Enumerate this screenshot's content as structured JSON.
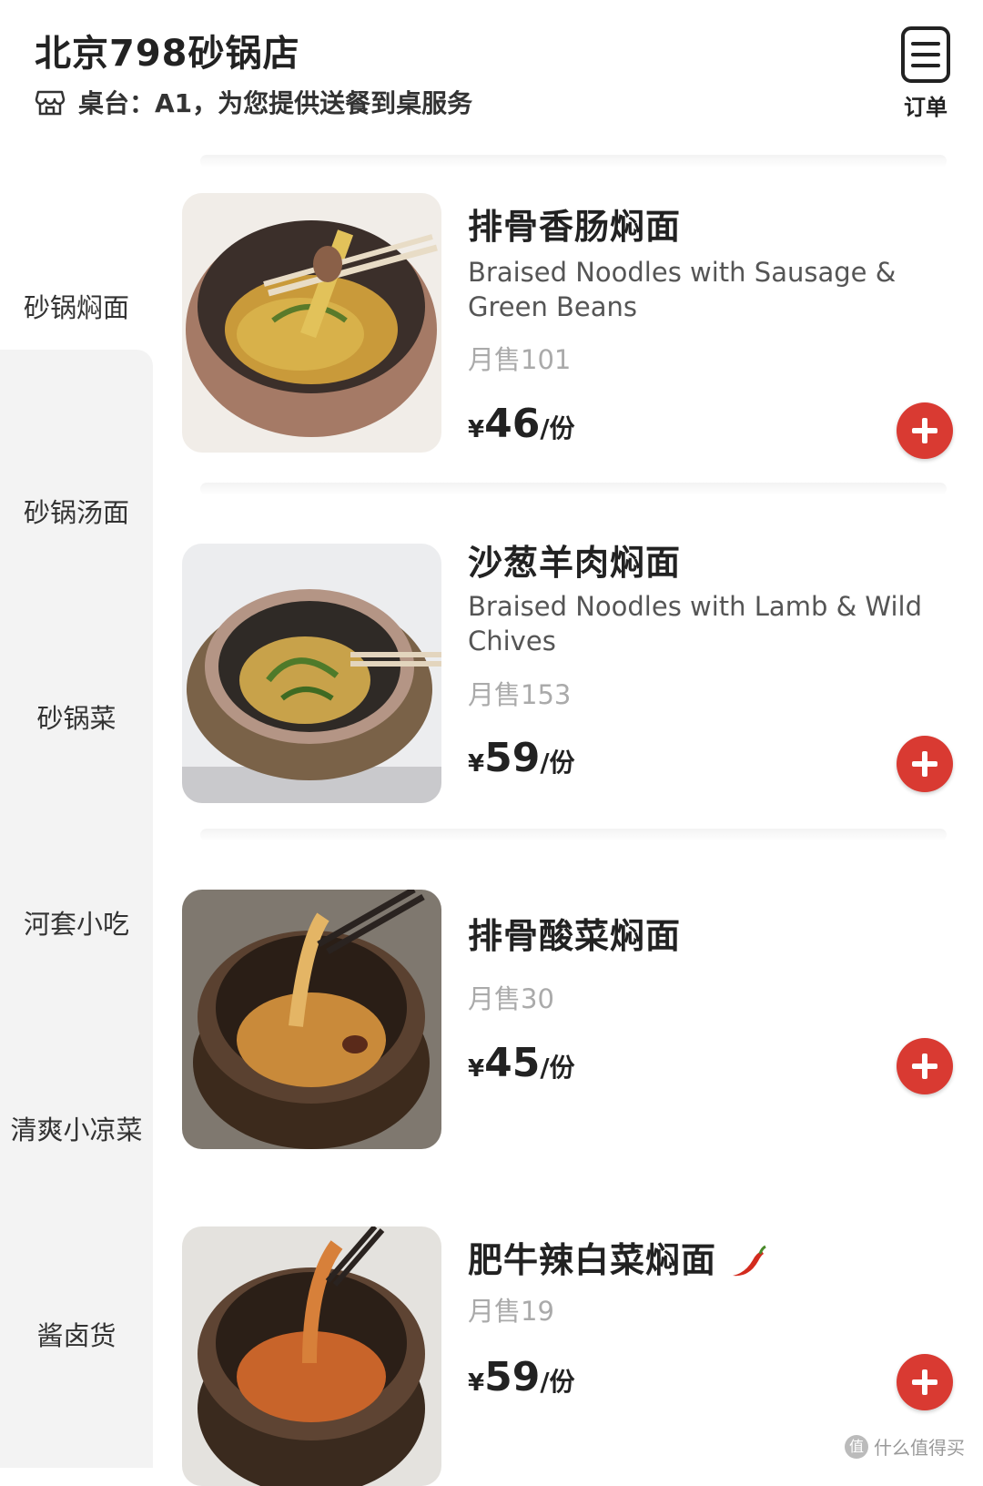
{
  "header": {
    "store_name": "北京798砂锅店",
    "table_text": "桌台：A1，为您提供送餐到桌服务",
    "orders_label": "订单"
  },
  "sidebar": {
    "selected_index": 0,
    "categories": [
      "砂锅焖面",
      "砂锅汤面",
      "砂锅菜",
      "河套小吃",
      "清爽小凉菜",
      "酱卤货"
    ]
  },
  "menu": {
    "currency": "¥",
    "unit": "/份",
    "items": [
      {
        "name": "排骨香肠焖面",
        "english": "Braised Noodles with Sausage & Green Beans",
        "sold": "月售101",
        "price": "46"
      },
      {
        "name": "沙葱羊肉焖面",
        "english": "Braised Noodles with Lamb & Wild Chives",
        "sold": "月售153",
        "price": "59"
      },
      {
        "name": "排骨酸菜焖面",
        "english": "",
        "sold": "月售30",
        "price": "45"
      },
      {
        "name": "肥牛辣白菜焖面",
        "english": "",
        "sold": "月售19",
        "price": "59",
        "spicy": true
      }
    ]
  },
  "icons": {
    "table": "store-icon",
    "orders": "order-list-icon",
    "add": "plus-icon",
    "spicy": "chili-pepper-icon"
  },
  "watermark": "什么值得买",
  "colors": {
    "accent": "#d93a32",
    "sidebar_bg": "#f3f3f3"
  }
}
